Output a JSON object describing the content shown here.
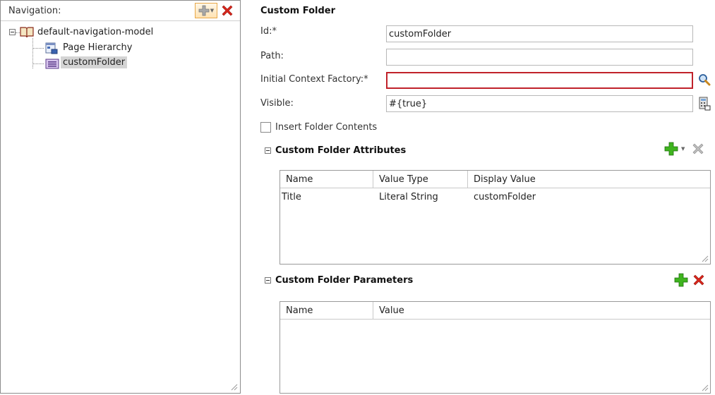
{
  "navigation": {
    "title": "Navigation:",
    "tree": {
      "root": {
        "label": "default-navigation-model",
        "expanded": true
      },
      "children": [
        {
          "label": "Page Hierarchy",
          "selected": false
        },
        {
          "label": "customFolder",
          "selected": true
        }
      ]
    }
  },
  "form": {
    "section_title": "Custom Folder",
    "fields": {
      "id": {
        "label": "Id:*",
        "value": "customFolder"
      },
      "path": {
        "label": "Path:",
        "value": ""
      },
      "initial_context_factory": {
        "label": "Initial Context Factory:*",
        "value": ""
      },
      "visible": {
        "label": "Visible:",
        "value": "#{true}"
      }
    },
    "insert_folder_contents": {
      "label": "Insert Folder Contents",
      "checked": false
    }
  },
  "attributes": {
    "title": "Custom Folder Attributes",
    "columns": [
      "Name",
      "Value Type",
      "Display Value"
    ],
    "rows": [
      [
        "Title",
        "Literal String",
        "customFolder"
      ]
    ]
  },
  "parameters": {
    "title": "Custom Folder Parameters",
    "columns": [
      "Name",
      "Value"
    ],
    "rows": []
  },
  "colors": {
    "accent_add": "#2e9e1e",
    "delete": "#d9261c",
    "error_border": "#c0222a",
    "selection": "#d4d4d4"
  }
}
